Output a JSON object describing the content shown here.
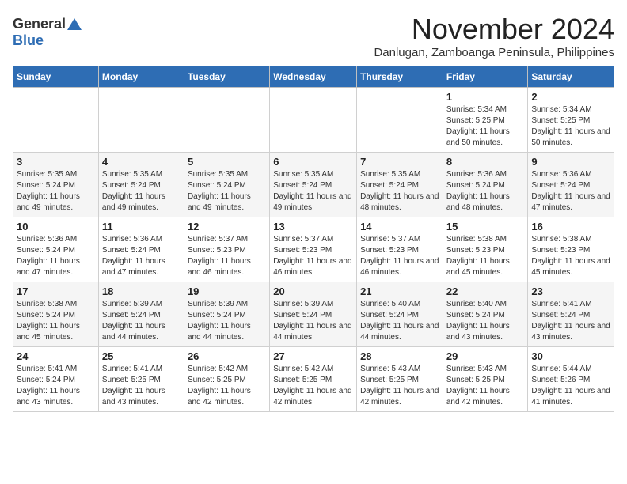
{
  "logo": {
    "general": "General",
    "blue": "Blue"
  },
  "title": "November 2024",
  "location": "Danlugan, Zamboanga Peninsula, Philippines",
  "headers": [
    "Sunday",
    "Monday",
    "Tuesday",
    "Wednesday",
    "Thursday",
    "Friday",
    "Saturday"
  ],
  "weeks": [
    [
      {
        "day": "",
        "info": ""
      },
      {
        "day": "",
        "info": ""
      },
      {
        "day": "",
        "info": ""
      },
      {
        "day": "",
        "info": ""
      },
      {
        "day": "",
        "info": ""
      },
      {
        "day": "1",
        "info": "Sunrise: 5:34 AM\nSunset: 5:25 PM\nDaylight: 11 hours and 50 minutes."
      },
      {
        "day": "2",
        "info": "Sunrise: 5:34 AM\nSunset: 5:25 PM\nDaylight: 11 hours and 50 minutes."
      }
    ],
    [
      {
        "day": "3",
        "info": "Sunrise: 5:35 AM\nSunset: 5:24 PM\nDaylight: 11 hours and 49 minutes."
      },
      {
        "day": "4",
        "info": "Sunrise: 5:35 AM\nSunset: 5:24 PM\nDaylight: 11 hours and 49 minutes."
      },
      {
        "day": "5",
        "info": "Sunrise: 5:35 AM\nSunset: 5:24 PM\nDaylight: 11 hours and 49 minutes."
      },
      {
        "day": "6",
        "info": "Sunrise: 5:35 AM\nSunset: 5:24 PM\nDaylight: 11 hours and 49 minutes."
      },
      {
        "day": "7",
        "info": "Sunrise: 5:35 AM\nSunset: 5:24 PM\nDaylight: 11 hours and 48 minutes."
      },
      {
        "day": "8",
        "info": "Sunrise: 5:36 AM\nSunset: 5:24 PM\nDaylight: 11 hours and 48 minutes."
      },
      {
        "day": "9",
        "info": "Sunrise: 5:36 AM\nSunset: 5:24 PM\nDaylight: 11 hours and 47 minutes."
      }
    ],
    [
      {
        "day": "10",
        "info": "Sunrise: 5:36 AM\nSunset: 5:24 PM\nDaylight: 11 hours and 47 minutes."
      },
      {
        "day": "11",
        "info": "Sunrise: 5:36 AM\nSunset: 5:24 PM\nDaylight: 11 hours and 47 minutes."
      },
      {
        "day": "12",
        "info": "Sunrise: 5:37 AM\nSunset: 5:23 PM\nDaylight: 11 hours and 46 minutes."
      },
      {
        "day": "13",
        "info": "Sunrise: 5:37 AM\nSunset: 5:23 PM\nDaylight: 11 hours and 46 minutes."
      },
      {
        "day": "14",
        "info": "Sunrise: 5:37 AM\nSunset: 5:23 PM\nDaylight: 11 hours and 46 minutes."
      },
      {
        "day": "15",
        "info": "Sunrise: 5:38 AM\nSunset: 5:23 PM\nDaylight: 11 hours and 45 minutes."
      },
      {
        "day": "16",
        "info": "Sunrise: 5:38 AM\nSunset: 5:23 PM\nDaylight: 11 hours and 45 minutes."
      }
    ],
    [
      {
        "day": "17",
        "info": "Sunrise: 5:38 AM\nSunset: 5:24 PM\nDaylight: 11 hours and 45 minutes."
      },
      {
        "day": "18",
        "info": "Sunrise: 5:39 AM\nSunset: 5:24 PM\nDaylight: 11 hours and 44 minutes."
      },
      {
        "day": "19",
        "info": "Sunrise: 5:39 AM\nSunset: 5:24 PM\nDaylight: 11 hours and 44 minutes."
      },
      {
        "day": "20",
        "info": "Sunrise: 5:39 AM\nSunset: 5:24 PM\nDaylight: 11 hours and 44 minutes."
      },
      {
        "day": "21",
        "info": "Sunrise: 5:40 AM\nSunset: 5:24 PM\nDaylight: 11 hours and 44 minutes."
      },
      {
        "day": "22",
        "info": "Sunrise: 5:40 AM\nSunset: 5:24 PM\nDaylight: 11 hours and 43 minutes."
      },
      {
        "day": "23",
        "info": "Sunrise: 5:41 AM\nSunset: 5:24 PM\nDaylight: 11 hours and 43 minutes."
      }
    ],
    [
      {
        "day": "24",
        "info": "Sunrise: 5:41 AM\nSunset: 5:24 PM\nDaylight: 11 hours and 43 minutes."
      },
      {
        "day": "25",
        "info": "Sunrise: 5:41 AM\nSunset: 5:25 PM\nDaylight: 11 hours and 43 minutes."
      },
      {
        "day": "26",
        "info": "Sunrise: 5:42 AM\nSunset: 5:25 PM\nDaylight: 11 hours and 42 minutes."
      },
      {
        "day": "27",
        "info": "Sunrise: 5:42 AM\nSunset: 5:25 PM\nDaylight: 11 hours and 42 minutes."
      },
      {
        "day": "28",
        "info": "Sunrise: 5:43 AM\nSunset: 5:25 PM\nDaylight: 11 hours and 42 minutes."
      },
      {
        "day": "29",
        "info": "Sunrise: 5:43 AM\nSunset: 5:25 PM\nDaylight: 11 hours and 42 minutes."
      },
      {
        "day": "30",
        "info": "Sunrise: 5:44 AM\nSunset: 5:26 PM\nDaylight: 11 hours and 41 minutes."
      }
    ]
  ]
}
